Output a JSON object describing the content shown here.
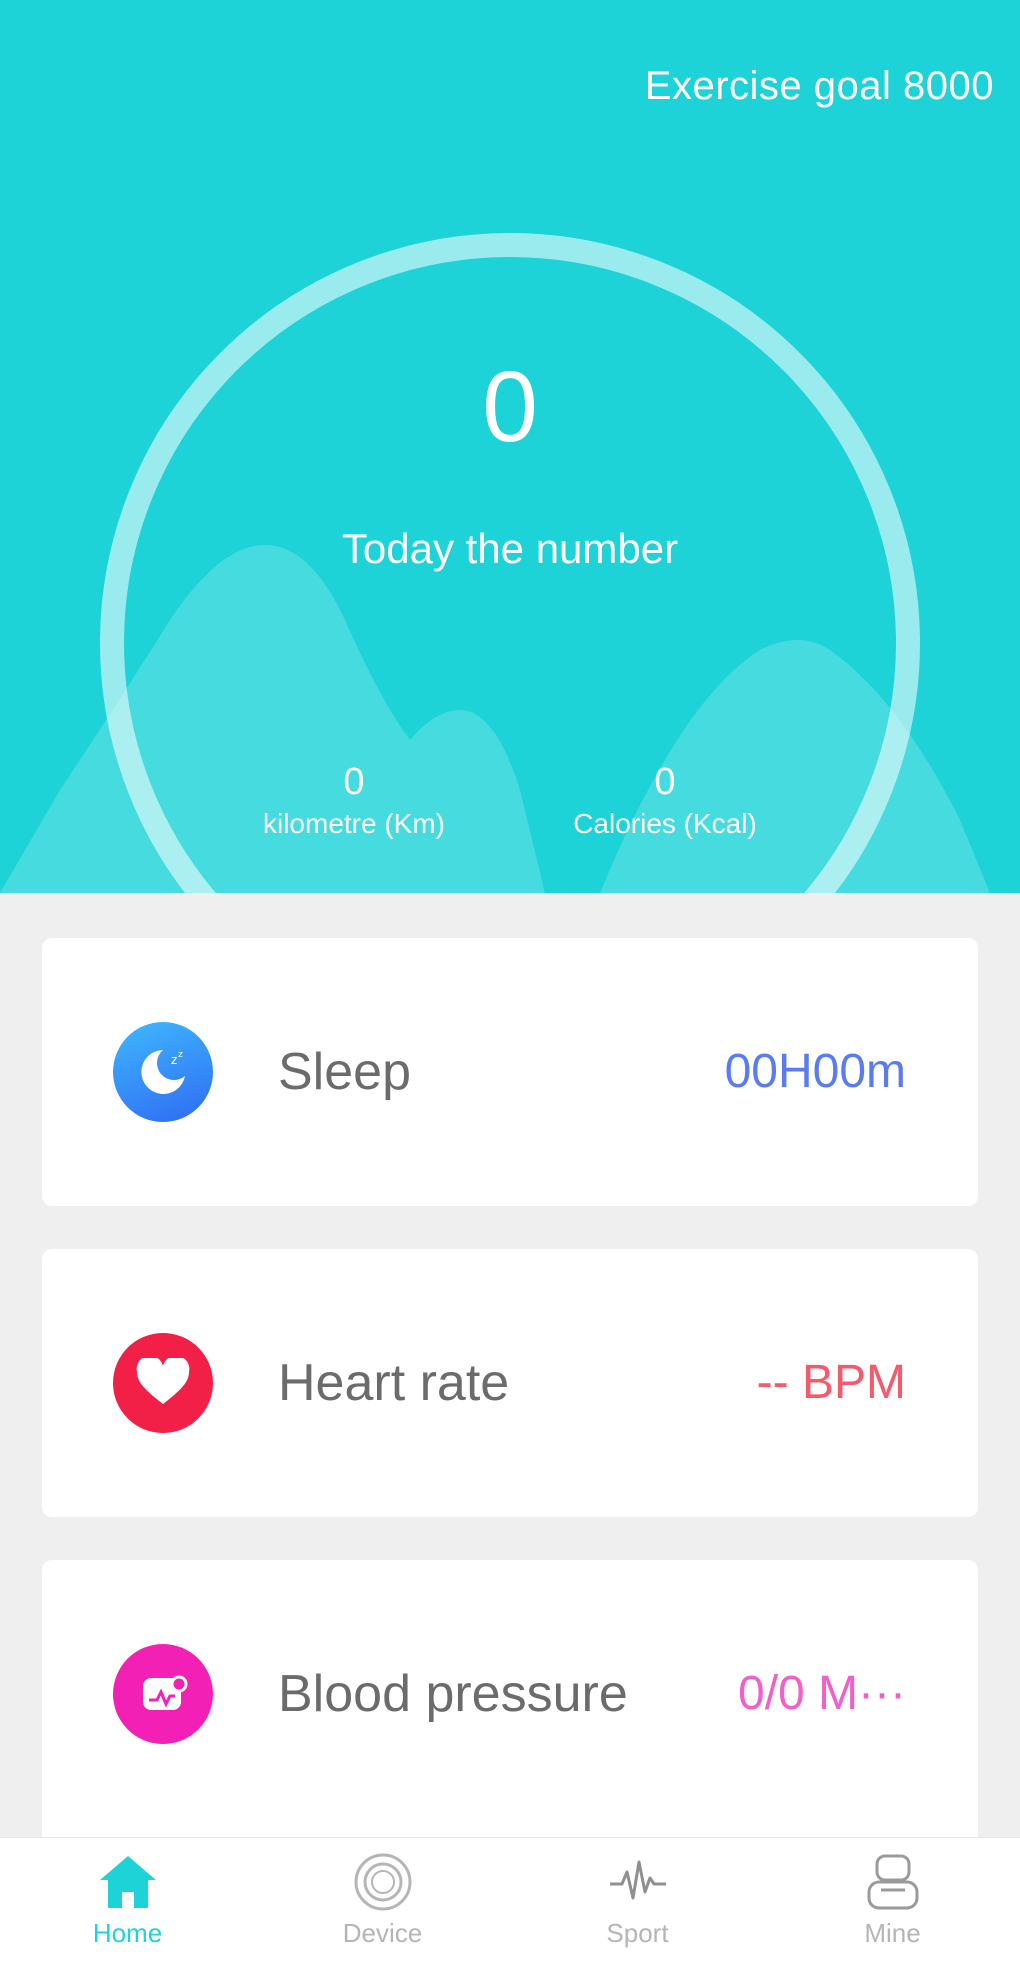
{
  "header": {
    "exercise_goal": "Exercise goal 8000",
    "steps_value": "0",
    "steps_label": "Today the number",
    "distance": {
      "value": "0",
      "label": "kilometre (Km)"
    },
    "calories": {
      "value": "0",
      "label": "Calories (Kcal)"
    }
  },
  "cards": [
    {
      "title": "Sleep",
      "value": "00H00m",
      "icon": "sleep-moon-icon",
      "color": "#5a7cf2"
    },
    {
      "title": "Heart rate",
      "value": "-- BPM",
      "icon": "heart-icon",
      "color": "#f45a6a"
    },
    {
      "title": "Blood pressure",
      "value": "0/0 M···",
      "icon": "blood-pressure-icon",
      "color": "#f15fc8"
    }
  ],
  "tabbar": [
    {
      "label": "Home",
      "icon": "home-icon",
      "active": true
    },
    {
      "label": "Device",
      "icon": "device-watch-icon",
      "active": false
    },
    {
      "label": "Sport",
      "icon": "sport-pulse-icon",
      "active": false
    },
    {
      "label": "Mine",
      "icon": "user-profile-icon",
      "active": false
    }
  ],
  "colors": {
    "accent": "#1ed3d8",
    "inactive_tab": "#b5b5b5"
  }
}
